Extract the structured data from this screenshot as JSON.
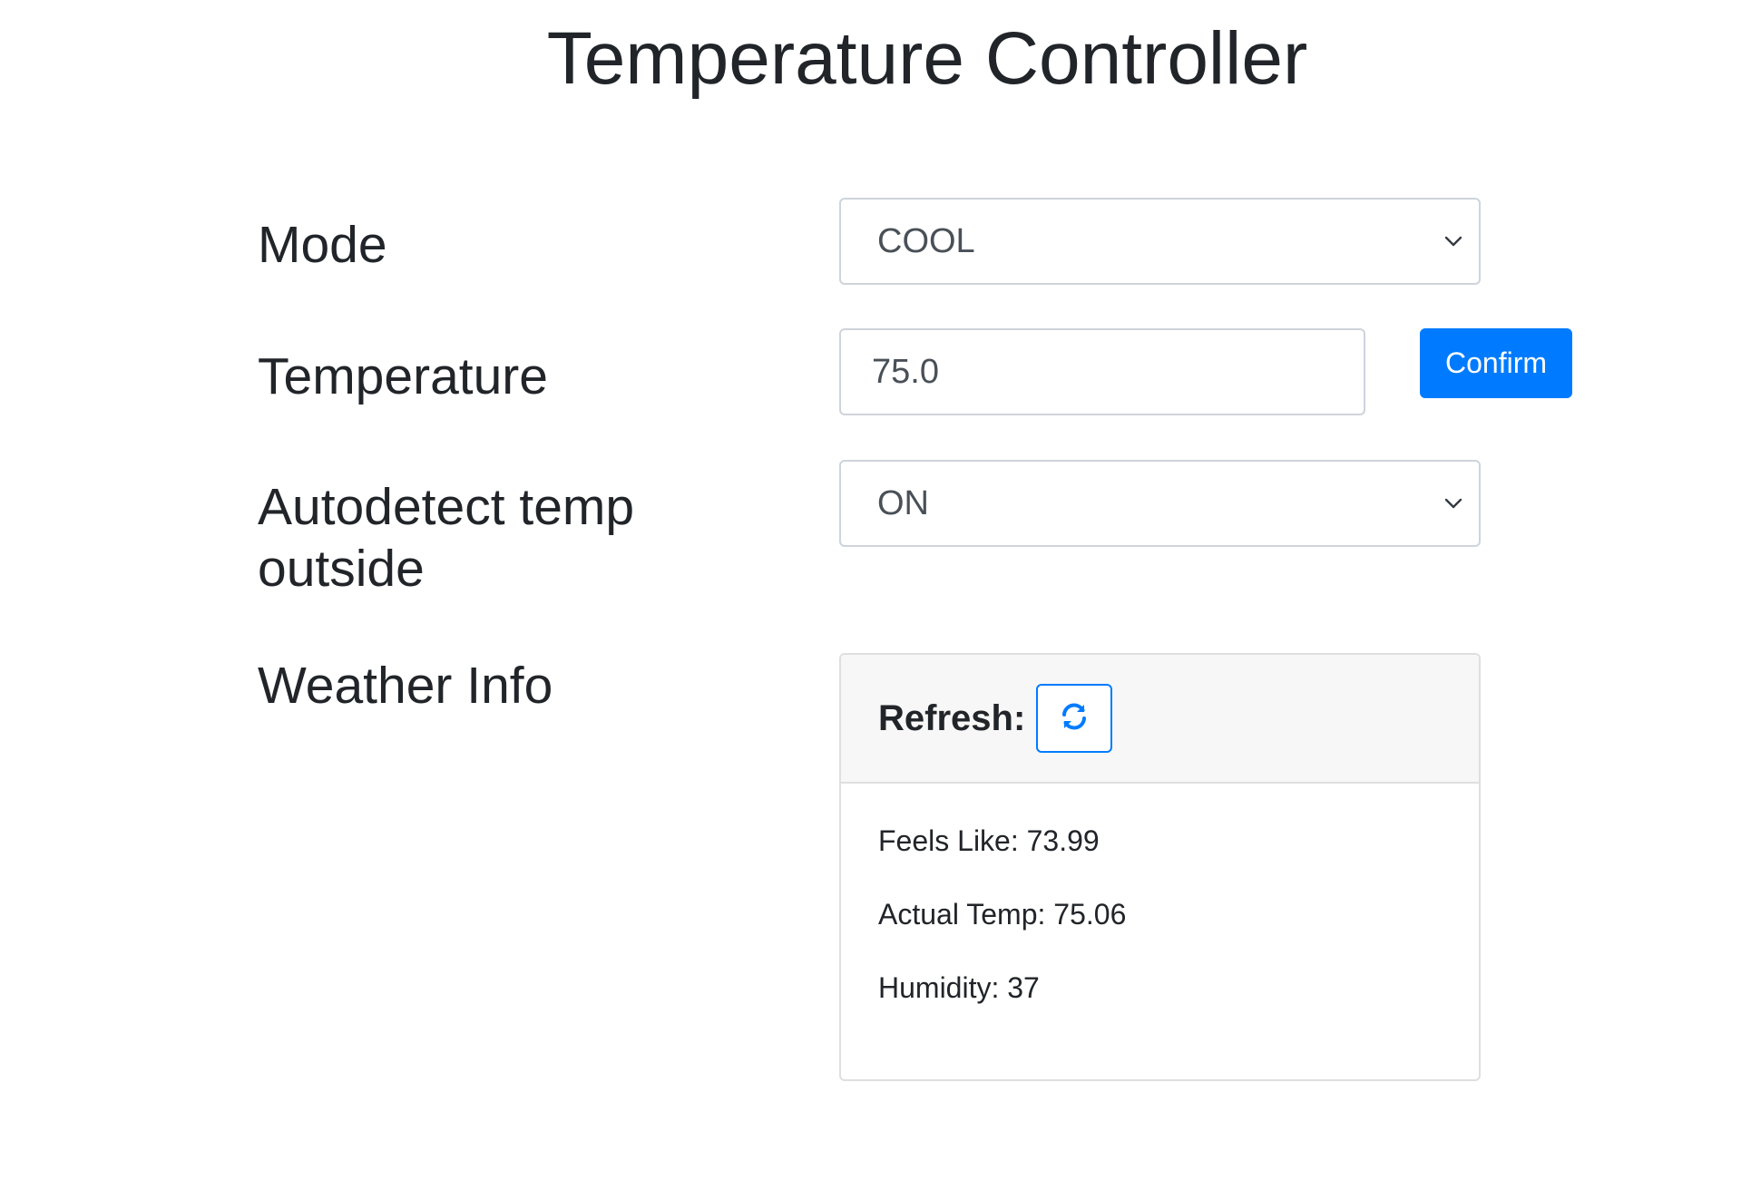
{
  "page": {
    "title": "Temperature Controller"
  },
  "form": {
    "mode": {
      "label": "Mode",
      "selected": "COOL"
    },
    "temperature": {
      "label": "Temperature",
      "value": "75.0",
      "confirm_label": "Confirm"
    },
    "autodetect": {
      "label_line1": "Autodetect temp",
      "label_line2": "outside",
      "selected": "ON"
    },
    "weather": {
      "label": "Weather Info",
      "refresh_label": "Refresh:",
      "feels_like": "Feels Like: 73.99",
      "actual_temp": "Actual Temp: 75.06",
      "humidity": "Humidity: 37"
    }
  },
  "colors": {
    "primary": "#007bff",
    "text": "#212529",
    "border": "#ced4da",
    "card_header_bg": "#f7f7f7"
  },
  "icons": {
    "select_chevron": "chevron-down-icon",
    "refresh": "refresh-icon"
  }
}
